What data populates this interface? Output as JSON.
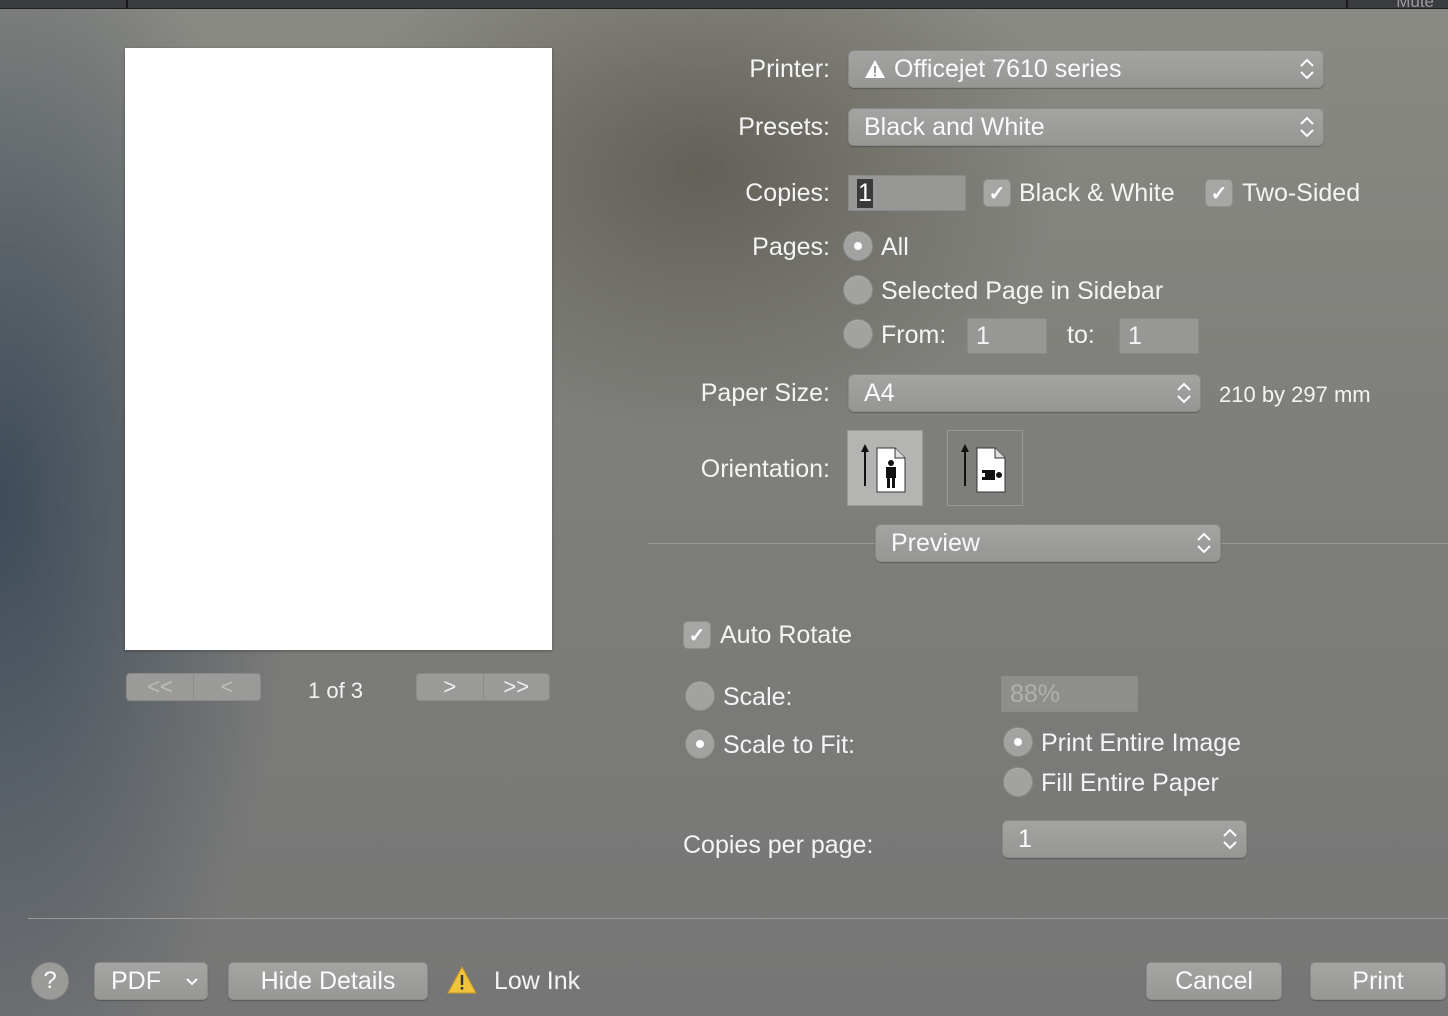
{
  "topbar": {
    "mute_label": "Mute"
  },
  "preview": {
    "page_indicator": "1 of 3",
    "first_label": "<<",
    "prev_label": "<",
    "next_label": ">",
    "last_label": ">>"
  },
  "printer": {
    "label": "Printer:",
    "value": "Officejet 7610 series",
    "status_icon": "warning-triangle-icon"
  },
  "presets": {
    "label": "Presets:",
    "value": "Black and White"
  },
  "copies": {
    "label": "Copies:",
    "value": "1",
    "bw_label": "Black & White",
    "bw_checked": true,
    "two_sided_label": "Two-Sided",
    "two_sided_checked": true
  },
  "pages": {
    "label": "Pages:",
    "all_label": "All",
    "selected_label": "Selected Page in Sidebar",
    "from_label": "From:",
    "from_value": "1",
    "to_label": "to:",
    "to_value": "1",
    "selected_option": "All"
  },
  "paper": {
    "label": "Paper Size:",
    "value": "A4",
    "dimensions": "210 by 297 mm"
  },
  "orientation": {
    "label": "Orientation:",
    "selected": "portrait",
    "options": [
      "portrait",
      "landscape"
    ]
  },
  "section": {
    "value": "Preview"
  },
  "preview_options": {
    "auto_rotate_label": "Auto Rotate",
    "auto_rotate_checked": true,
    "scale_label": "Scale:",
    "scale_value": "88%",
    "scale_to_fit_label": "Scale to Fit:",
    "scale_mode": "Scale to Fit",
    "print_entire_label": "Print Entire Image",
    "fill_paper_label": "Fill Entire Paper",
    "fit_mode": "Print Entire Image",
    "copies_per_page_label": "Copies per page:",
    "copies_per_page_value": "1"
  },
  "footer": {
    "help_label": "?",
    "pdf_label": "PDF",
    "hide_details_label": "Hide Details",
    "status_text": "Low Ink",
    "status_icon": "warning-triangle-icon",
    "cancel_label": "Cancel",
    "print_label": "Print"
  },
  "colors": {
    "warning": "#f0c33c",
    "dialog_bg": "#808080"
  }
}
